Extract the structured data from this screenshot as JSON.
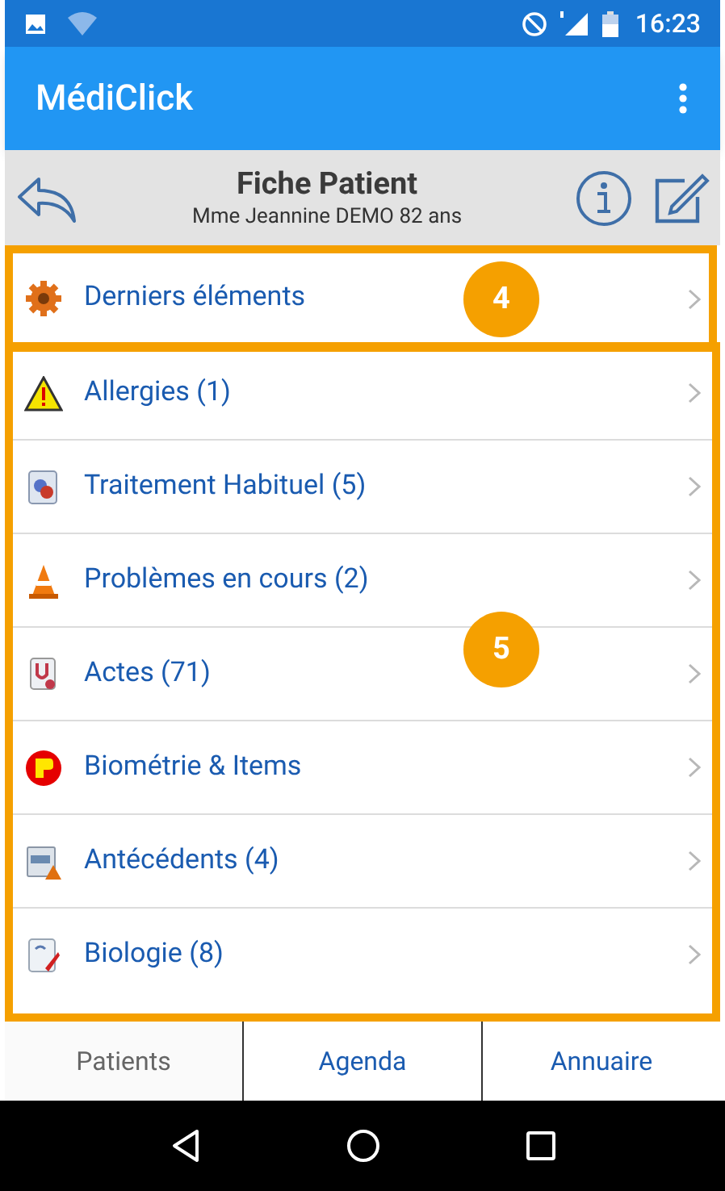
{
  "status_bar": {
    "time": "16:23"
  },
  "app_bar": {
    "title": "MédiClick"
  },
  "header": {
    "title": "Fiche Patient",
    "subtitle": "Mme Jeannine DEMO 82 ans"
  },
  "list": [
    {
      "label": "Derniers éléments"
    },
    {
      "label": "Allergies (1)"
    },
    {
      "label": "Traitement Habituel (5)"
    },
    {
      "label": "Problèmes en cours (2)"
    },
    {
      "label": "Actes (71)"
    },
    {
      "label": "Biométrie & Items"
    },
    {
      "label": "Antécédents (4)"
    },
    {
      "label": "Biologie (8)"
    }
  ],
  "callouts": [
    {
      "label": "4"
    },
    {
      "label": "5"
    }
  ],
  "tabs": [
    {
      "label": "Patients",
      "selected": true
    },
    {
      "label": "Agenda",
      "selected": false
    },
    {
      "label": "Annuaire",
      "selected": false
    }
  ]
}
